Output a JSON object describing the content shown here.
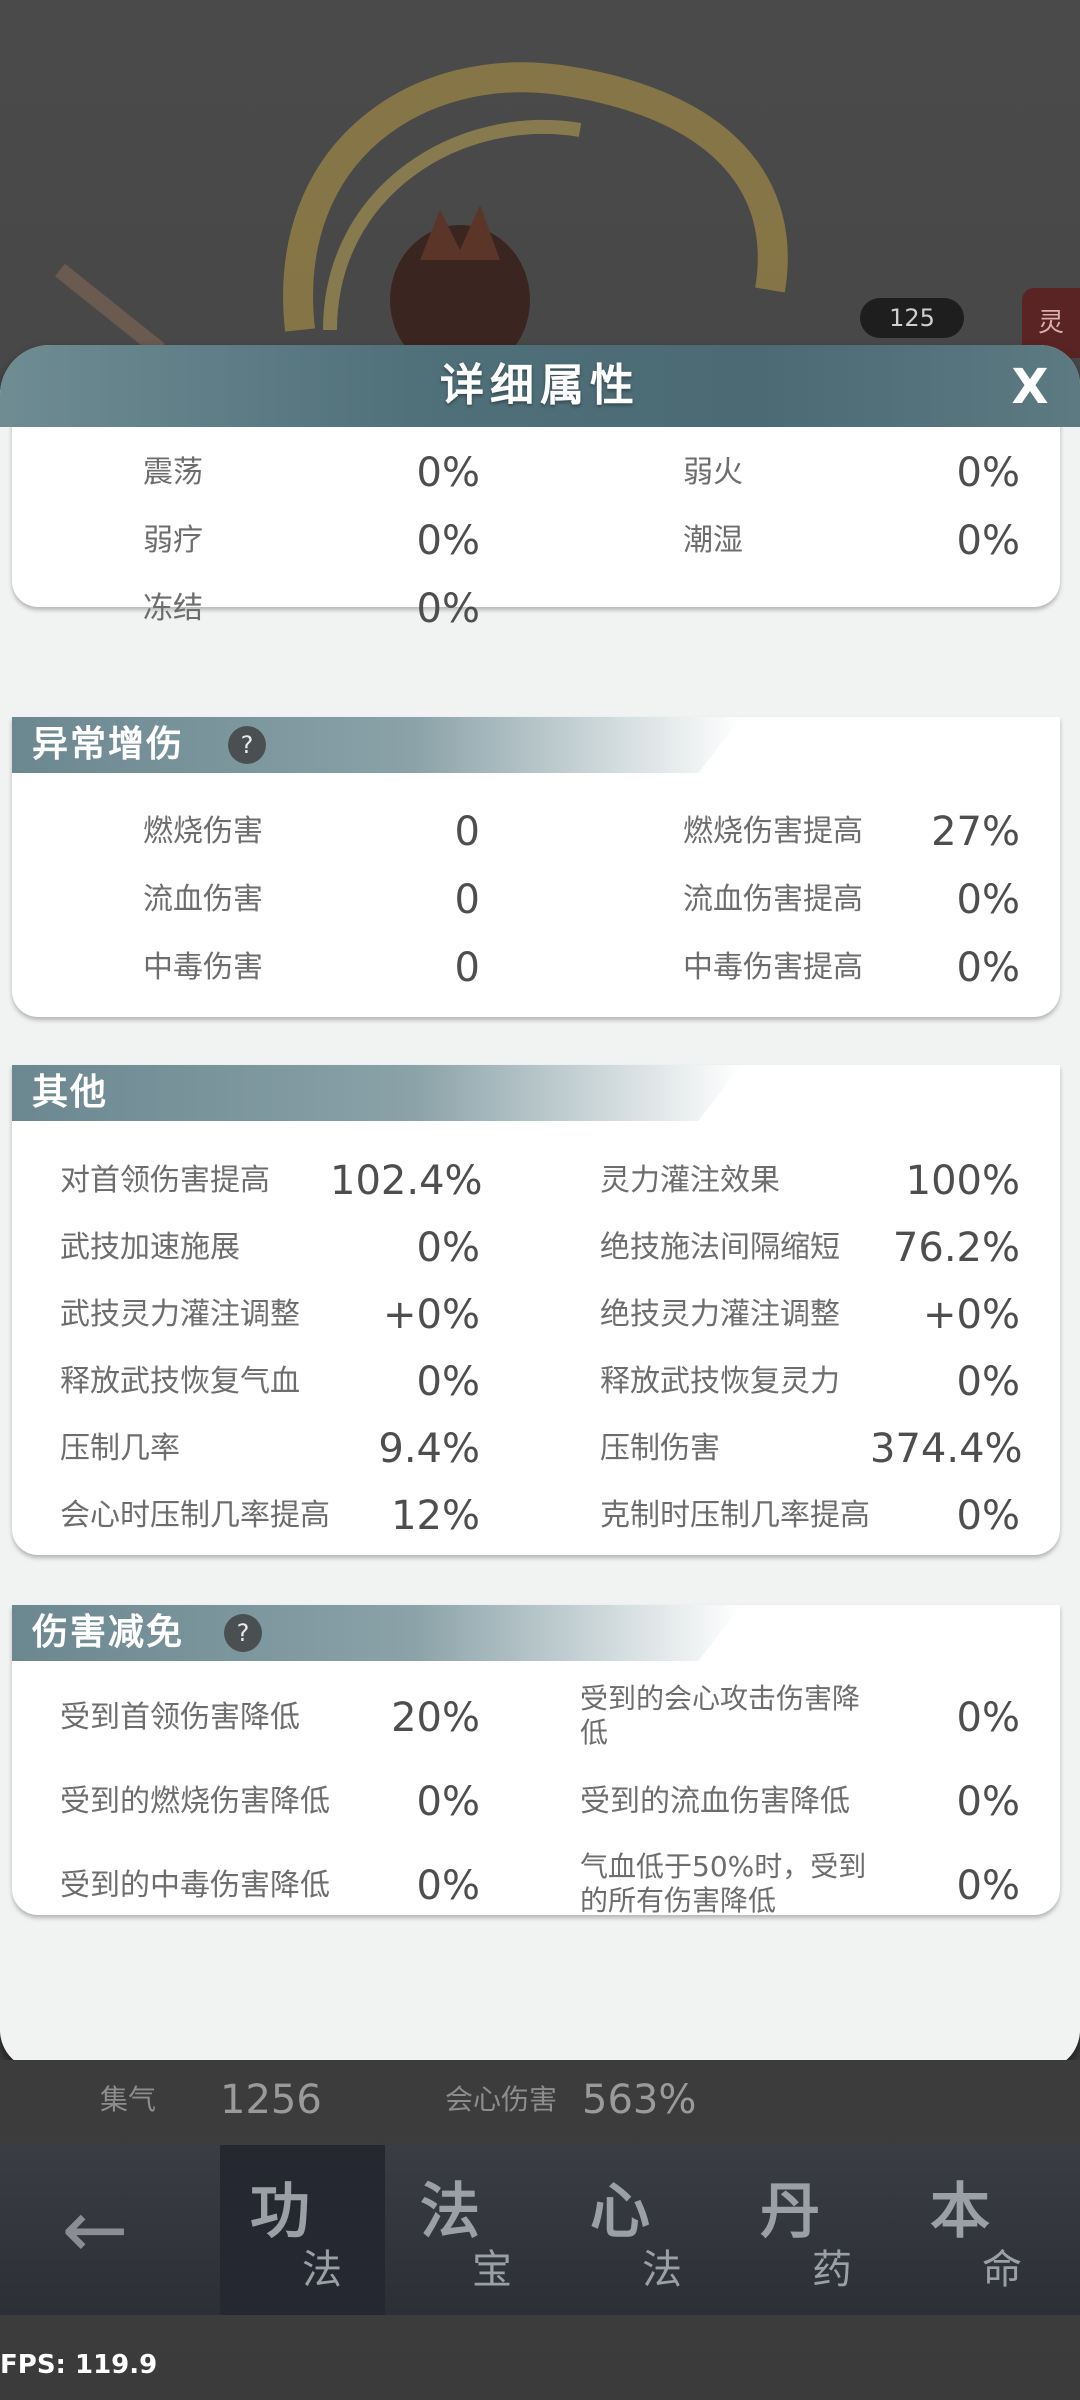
{
  "header": {
    "title": "详细属性",
    "close_label": "X"
  },
  "top_partial": {
    "rows": [
      {
        "left_label": "震荡",
        "left_value": "0%",
        "right_label": "弱火",
        "right_value": "0%"
      },
      {
        "left_label": "弱疗",
        "left_value": "0%",
        "right_label": "潮湿",
        "right_value": "0%"
      },
      {
        "left_label": "冻结",
        "left_value": "0%",
        "right_label": "",
        "right_value": ""
      }
    ]
  },
  "sections": {
    "abnormal": {
      "title": "异常增伤",
      "rows": [
        {
          "left_label": "燃烧伤害",
          "left_value": "0",
          "right_label": "燃烧伤害提高",
          "right_value": "27%"
        },
        {
          "left_label": "流血伤害",
          "left_value": "0",
          "right_label": "流血伤害提高",
          "right_value": "0%"
        },
        {
          "left_label": "中毒伤害",
          "left_value": "0",
          "right_label": "中毒伤害提高",
          "right_value": "0%"
        }
      ]
    },
    "other": {
      "title": "其他",
      "rows": [
        {
          "left_label": "对首领伤害提高",
          "left_value": "102.4%",
          "right_label": "灵力灌注效果",
          "right_value": "100%"
        },
        {
          "left_label": "武技加速施展",
          "left_value": "0%",
          "right_label": "绝技施法间隔缩短",
          "right_value": "76.2%"
        },
        {
          "left_label": "武技灵力灌注调整",
          "left_value": "+0%",
          "right_label": "绝技灵力灌注调整",
          "right_value": "+0%"
        },
        {
          "left_label": "释放武技恢复气血",
          "left_value": "0%",
          "right_label": "释放武技恢复灵力",
          "right_value": "0%"
        },
        {
          "left_label": "压制几率",
          "left_value": "9.4%",
          "right_label": "压制伤害",
          "right_value": "374.4%"
        },
        {
          "left_label": "会心时压制几率提高",
          "left_value": "12%",
          "right_label": "克制时压制几率提高",
          "right_value": "0%"
        }
      ]
    },
    "reduction": {
      "title": "伤害减免",
      "rows": [
        {
          "left_label": "受到首领伤害降低",
          "left_value": "20%",
          "right_label": "受到的会心攻击伤害降低",
          "right_value": "0%"
        },
        {
          "left_label": "受到的燃烧伤害降低",
          "left_value": "0%",
          "right_label": "受到的流血伤害降低",
          "right_value": "0%"
        },
        {
          "left_label": "受到的中毒伤害降低",
          "left_value": "0%",
          "right_label": "气血低于50%时，受到的所有伤害降低",
          "right_value": "0%"
        }
      ]
    }
  },
  "background": {
    "level_badge": "125",
    "side_tab": "灵"
  },
  "stats_strip": {
    "gather_label": "集气",
    "gather_value": "1256",
    "crit_label": "会心伤害",
    "crit_value": "563%"
  },
  "bottom_nav": {
    "back_icon": "arrow-left-icon",
    "tabs": [
      {
        "big": "功",
        "small": "法"
      },
      {
        "big": "法",
        "small": "宝"
      },
      {
        "big": "心",
        "small": "法"
      },
      {
        "big": "丹",
        "small": "药"
      },
      {
        "big": "本",
        "small": "命"
      }
    ]
  },
  "fps": "FPS: 119.9",
  "colors": {
    "header_teal": "#4f6f79",
    "panel_bg": "#ffffff",
    "dialog_bg": "#f1f2f2",
    "text_label": "#6d6d6d",
    "text_value": "#4e4e4e"
  }
}
